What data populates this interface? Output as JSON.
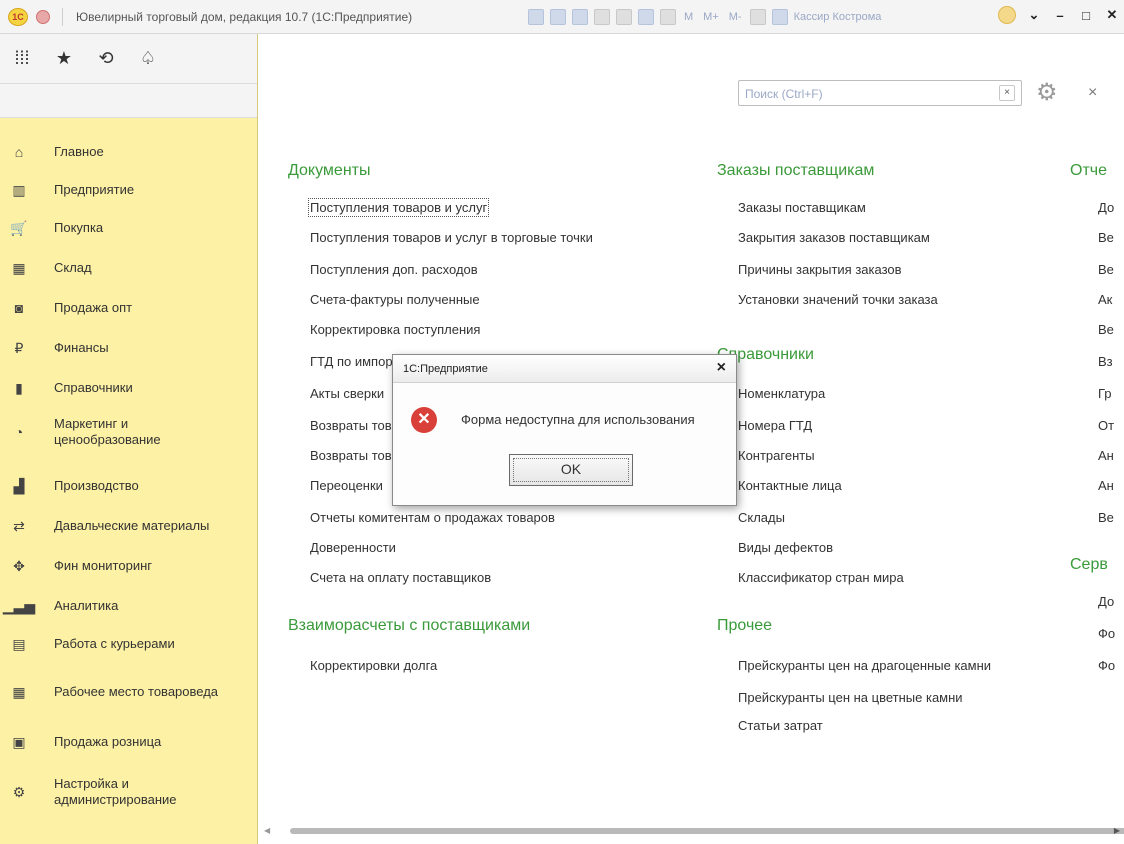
{
  "titlebar": {
    "title": "Ювелирный торговый дом, редакция 10.7 (1С:Предприятие)",
    "logo": "1С",
    "m": "M",
    "mplus": "M+",
    "mminus": "M-",
    "user": "Кассир Кострома"
  },
  "sidebar": {
    "items": [
      {
        "label": "Главное",
        "icon": "home-icon",
        "glyph": "⌂"
      },
      {
        "label": "Предприятие",
        "icon": "building-icon",
        "glyph": "▥"
      },
      {
        "label": "Покупка",
        "icon": "cart-icon",
        "glyph": "🛒"
      },
      {
        "label": "Склад",
        "icon": "warehouse-icon",
        "glyph": "▦"
      },
      {
        "label": "Продажа опт",
        "icon": "bag-icon",
        "glyph": "◙"
      },
      {
        "label": "Финансы",
        "icon": "ruble-icon",
        "glyph": "₽"
      },
      {
        "label": "Справочники",
        "icon": "book-icon",
        "glyph": "▮"
      },
      {
        "label": "Маркетинг и ценообразование",
        "icon": "pie-chart-icon",
        "glyph": "◔"
      },
      {
        "label": "Производство",
        "icon": "factory-icon",
        "glyph": "▟"
      },
      {
        "label": "Давальческие материалы",
        "icon": "materials-icon",
        "glyph": "⇄"
      },
      {
        "label": "Фин мониторинг",
        "icon": "eagle-icon",
        "glyph": "✥"
      },
      {
        "label": "Аналитика",
        "icon": "bar-chart-icon",
        "glyph": "▁▃▅"
      },
      {
        "label": "Работа с курьерами",
        "icon": "courier-icon",
        "glyph": "▤"
      },
      {
        "label": "Рабочее место товароведа",
        "icon": "workplace-icon",
        "glyph": "▦"
      },
      {
        "label": "Продажа розница",
        "icon": "register-icon",
        "glyph": "▣"
      },
      {
        "label": "Настройка и администрирование",
        "icon": "gear-icon",
        "glyph": "⚙"
      }
    ]
  },
  "search": {
    "placeholder": "Поиск (Ctrl+F)",
    "clear": "×"
  },
  "page_close": "×",
  "sections": {
    "documents": {
      "title": "Документы",
      "links": [
        "Поступления товаров и услуг",
        "Поступления товаров и услуг в торговые точки",
        "Поступления доп. расходов",
        "Счета-фактуры полученные",
        "Корректировка поступления",
        "ГТД по импорту",
        "Акты сверки",
        "Возвраты товаров",
        "Возвраты товаров",
        "Переоценки",
        "Отчеты комитентам о продажах товаров",
        "Доверенности",
        "Счета на оплату поставщиков"
      ]
    },
    "settlements": {
      "title": "Взаиморасчеты с поставщиками",
      "links": [
        "Корректировки долга"
      ]
    },
    "orders": {
      "title": "Заказы поставщикам",
      "links": [
        "Заказы поставщикам",
        "Закрытия заказов поставщикам",
        "Причины закрытия заказов",
        "Установки значений точки заказа"
      ]
    },
    "references": {
      "title": "Справочники",
      "links": [
        "Номенклатура",
        "Номера ГТД",
        "Контрагенты",
        "Контактные лица",
        "Склады",
        "Виды дефектов",
        "Классификатор стран мира"
      ]
    },
    "other": {
      "title": "Прочее",
      "links": [
        "Прейскуранты цен на драгоценные камни",
        "Прейскуранты цен на цветные камни",
        "Статьи затрат"
      ]
    },
    "reports": {
      "title": "Отче",
      "links": [
        "До",
        "Ве",
        "Ве",
        "Ак",
        "Ве",
        "Вз",
        "Гр",
        "От",
        "Ан",
        "Ан",
        "Ве"
      ]
    },
    "service": {
      "title": "Серв",
      "links": [
        "До",
        "Фо",
        "Фо"
      ]
    }
  },
  "dialog": {
    "title": "1С:Предприятие",
    "message": "Форма недоступна для использования",
    "ok": "OK",
    "close": "×",
    "error_glyph": "✕"
  }
}
